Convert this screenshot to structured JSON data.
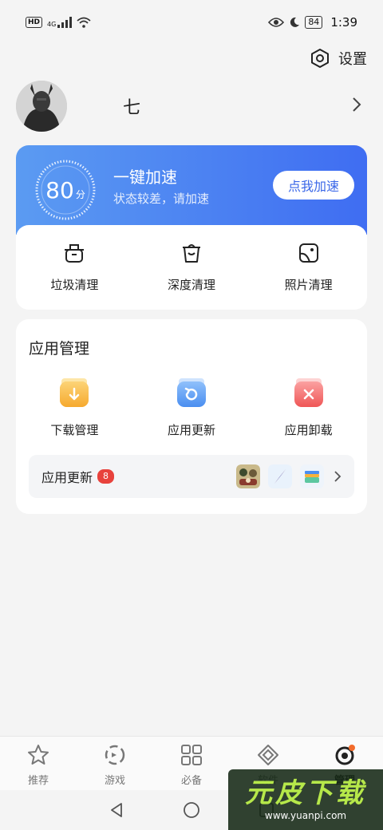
{
  "status_bar": {
    "hd": "HD",
    "network": "4G",
    "battery": "84",
    "time": "1:39"
  },
  "header": {
    "settings_label": "设置"
  },
  "profile": {
    "username": "七"
  },
  "speed_card": {
    "score": "80",
    "score_unit": "分",
    "title": "一键加速",
    "subtitle": "状态较差，请加速",
    "button_label": "点我加速",
    "score_fraction": 0.8
  },
  "clean": {
    "items": [
      {
        "label": "垃圾清理",
        "icon": "trash-basket-icon"
      },
      {
        "label": "深度清理",
        "icon": "trash-bin-icon"
      },
      {
        "label": "照片清理",
        "icon": "photo-icon"
      }
    ]
  },
  "app_management": {
    "title": "应用管理",
    "items": [
      {
        "label": "下载管理",
        "icon": "download-folder-icon",
        "color": "#f7b23b"
      },
      {
        "label": "应用更新",
        "icon": "update-folder-icon",
        "color": "#4a8ef0"
      },
      {
        "label": "应用卸载",
        "icon": "uninstall-folder-icon",
        "color": "#f06060"
      }
    ],
    "update_row": {
      "label": "应用更新",
      "badge": "8"
    }
  },
  "bottom_nav": {
    "items": [
      {
        "label": "推荐",
        "icon": "star-icon"
      },
      {
        "label": "游戏",
        "icon": "game-icon"
      },
      {
        "label": "必备",
        "icon": "grid-icon"
      },
      {
        "label": "软件",
        "icon": "diamond-icon"
      },
      {
        "label": "管理",
        "icon": "manage-icon",
        "active": true
      }
    ]
  },
  "watermark": {
    "main": "元皮下载",
    "sub": "www.yuanpi.com"
  },
  "colors": {
    "accent": "#3f6df2",
    "badge": "#e8423c"
  }
}
